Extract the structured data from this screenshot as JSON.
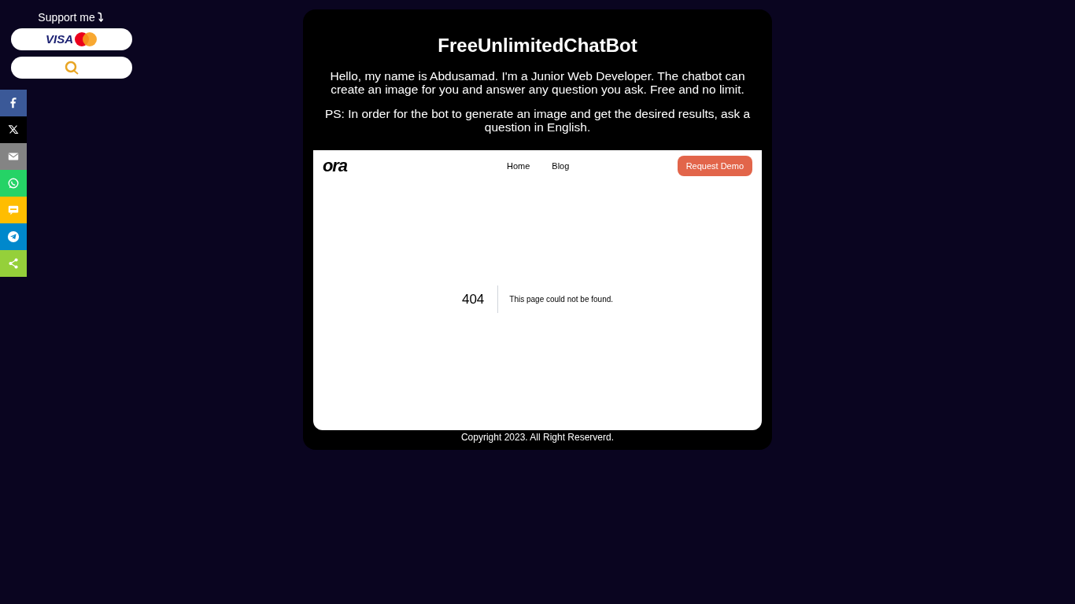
{
  "support": {
    "label": "Support me",
    "arrow": "⤵",
    "buttons": [
      {
        "kind": "cards",
        "text": "VISA"
      },
      {
        "kind": "qiwi"
      }
    ]
  },
  "share_bar": [
    {
      "kind": "facebook",
      "color": "#3b5998"
    },
    {
      "kind": "x",
      "color": "#000000"
    },
    {
      "kind": "email",
      "color": "#848484"
    },
    {
      "kind": "whatsapp",
      "color": "#25d366"
    },
    {
      "kind": "sms",
      "color": "#ffbd00"
    },
    {
      "kind": "telegram",
      "color": "#0088cc"
    },
    {
      "kind": "share",
      "color": "#95d03a"
    }
  ],
  "title": "FreeUnlimitedChatBot",
  "intro": "Hello, my name is Abdusamad. I'm a Junior Web Developer. The chatbot can create an image for you and answer any question you ask. Free and no limit.",
  "note": "PS: In order for the bot to generate an image and get the desired results, ask a question in English.",
  "embed": {
    "logo": "ora",
    "nav": [
      "Home",
      "Blog"
    ],
    "cta": "Request Demo",
    "code": "404",
    "message": "This page could not be found."
  },
  "footer": "Copyright 2023. All Right Reserverd."
}
